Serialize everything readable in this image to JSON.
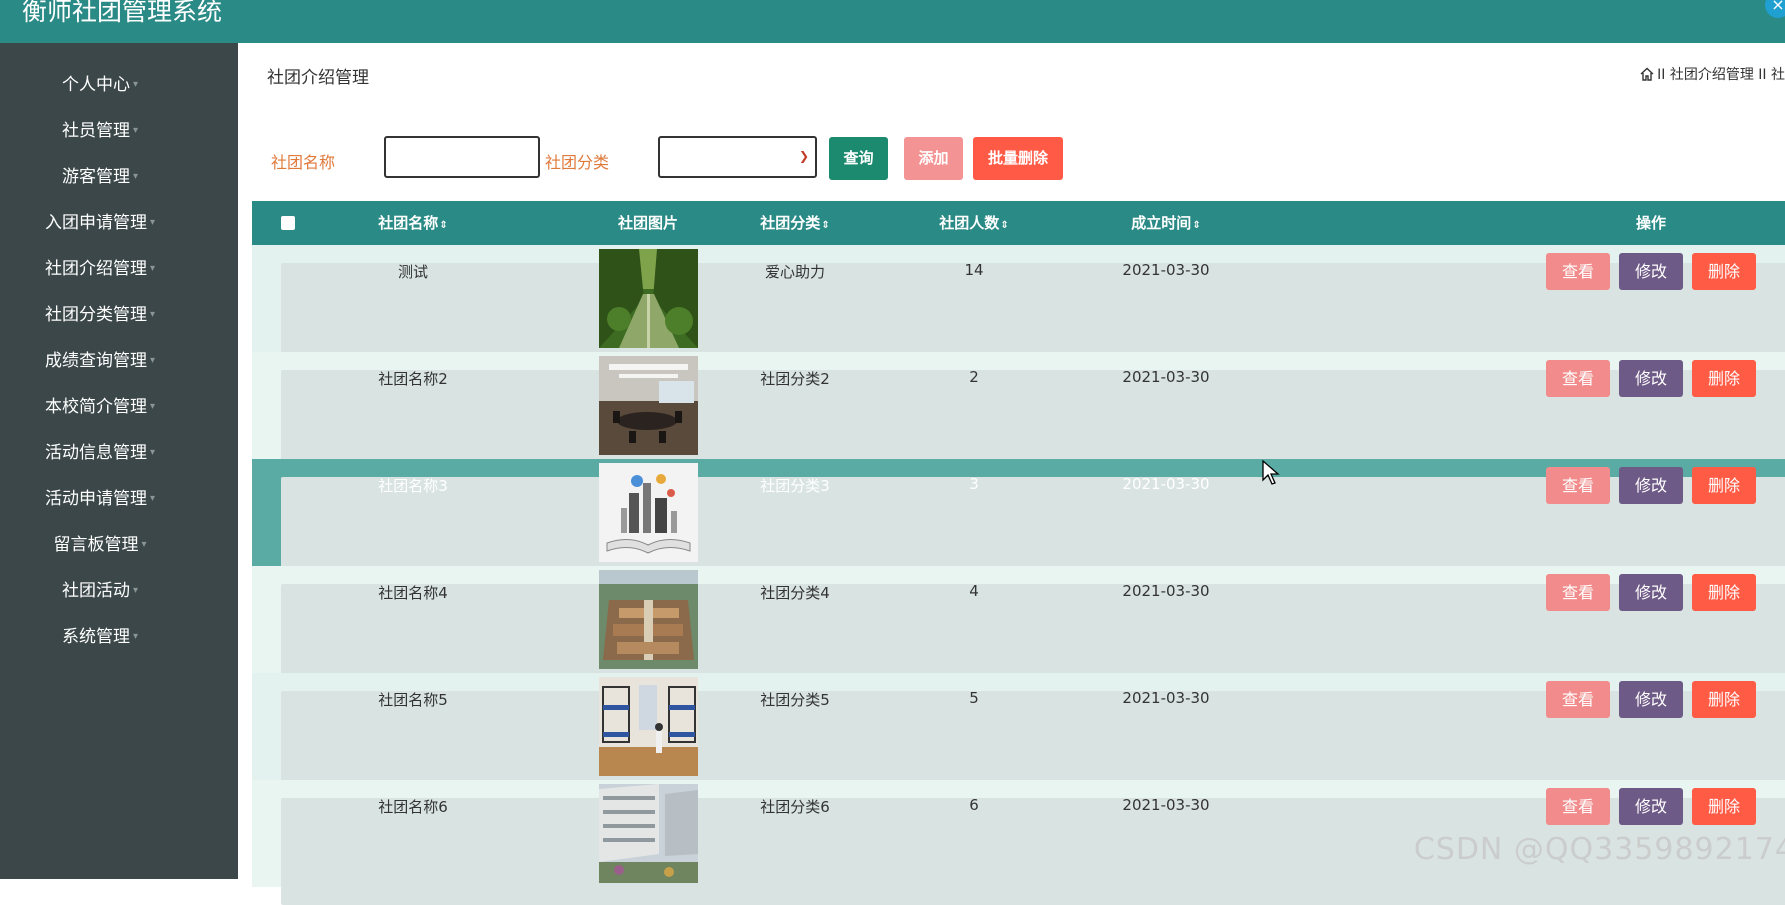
{
  "app": {
    "title": "衡师社团管理系统",
    "close_glyph": "×"
  },
  "sidebar": {
    "items": [
      {
        "label": "个人中心"
      },
      {
        "label": "社员管理"
      },
      {
        "label": "游客管理"
      },
      {
        "label": "入团申请管理"
      },
      {
        "label": "社团介绍管理"
      },
      {
        "label": "社团分类管理"
      },
      {
        "label": "成绩查询管理"
      },
      {
        "label": "本校简介管理"
      },
      {
        "label": "活动信息管理"
      },
      {
        "label": "活动申请管理"
      },
      {
        "label": "留言板管理"
      },
      {
        "label": "社团活动"
      },
      {
        "label": "系统管理"
      }
    ]
  },
  "page": {
    "title": "社团介绍管理",
    "breadcrumb": "II 社团介绍管理 II 社"
  },
  "search": {
    "name_label": "社团名称",
    "category_label": "社团分类",
    "name_value": "",
    "category_value": "",
    "search_button": "查询",
    "add_button": "添加",
    "batch_delete_button": "批量删除"
  },
  "table": {
    "headers": {
      "name": "社团名称",
      "image": "社团图片",
      "category": "社团分类",
      "members": "社团人数",
      "founded": "成立时间",
      "actions": "操作"
    },
    "sort_glyph": "⇕",
    "rows": [
      {
        "name": "测试",
        "category": "爱心助力",
        "members": "14",
        "founded": "2021-03-30",
        "image": "trees-avenue"
      },
      {
        "name": "社团名称2",
        "category": "社团分类2",
        "members": "2",
        "founded": "2021-03-30",
        "image": "conference-room"
      },
      {
        "name": "社团名称3",
        "category": "社团分类3",
        "members": "3",
        "founded": "2021-03-30",
        "image": "open-book"
      },
      {
        "name": "社团名称4",
        "category": "社团分类4",
        "members": "4",
        "founded": "2021-03-30",
        "image": "campus-aerial"
      },
      {
        "name": "社团名称5",
        "category": "社团分类5",
        "members": "5",
        "founded": "2021-03-30",
        "image": "dormitory"
      },
      {
        "name": "社团名称6",
        "category": "社团分类6",
        "members": "6",
        "founded": "2021-03-30",
        "image": "building-courtyard"
      }
    ],
    "row_actions": {
      "view": "查看",
      "edit": "修改",
      "delete": "删除"
    }
  },
  "watermark": "CSDN @QQ3359892174",
  "colors": {
    "header": "#2a8a86",
    "sidebar": "#3b4748",
    "label_orange": "#e07a3c",
    "highlight_row": "#5aaba4",
    "btn_view": "#f28b8b",
    "btn_edit": "#6e5a86",
    "btn_delete": "#ff5b45"
  }
}
